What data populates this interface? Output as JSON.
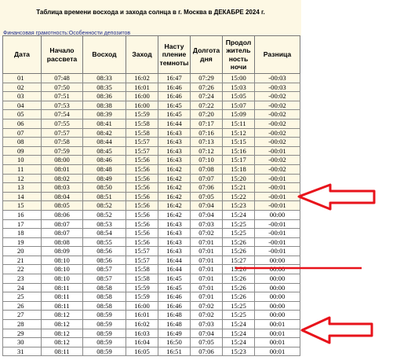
{
  "page_title": "Таблица времени восхода и захода солнца в г. Москва в ДЕКАБРЕ 2024 г.",
  "nav_link": "Финансовая грамотность:Особенности депозитов",
  "headers": [
    "Дата",
    "Начало рассвета",
    "Восход",
    "Заход",
    "Насту пление темноты",
    "Долгота дня",
    "Продол житель ность ночи",
    "Разница"
  ],
  "highlight_color": "#fdf8e4",
  "annotation_color": "#e8131b",
  "highlighted_rows": 15,
  "rows": [
    [
      "01",
      "07:48",
      "08:33",
      "16:02",
      "16:47",
      "07:29",
      "15:00",
      "-00:03"
    ],
    [
      "02",
      "07:50",
      "08:35",
      "16:01",
      "16:46",
      "07:26",
      "15:03",
      "-00:03"
    ],
    [
      "03",
      "07:51",
      "08:36",
      "16:00",
      "16:46",
      "07:24",
      "15:05",
      "-00:02"
    ],
    [
      "04",
      "07:53",
      "08:38",
      "16:00",
      "16:45",
      "07:22",
      "15:07",
      "-00:02"
    ],
    [
      "05",
      "07:54",
      "08:39",
      "15:59",
      "16:45",
      "07:20",
      "15:09",
      "-00:02"
    ],
    [
      "06",
      "07:55",
      "08:41",
      "15:58",
      "16:44",
      "07:17",
      "15:11",
      "-00:02"
    ],
    [
      "07",
      "07:57",
      "08:42",
      "15:58",
      "16:43",
      "07:16",
      "15:12",
      "-00:02"
    ],
    [
      "08",
      "07:58",
      "08:44",
      "15:57",
      "16:43",
      "07:13",
      "15:15",
      "-00:02"
    ],
    [
      "09",
      "07:59",
      "08:45",
      "15:57",
      "16:43",
      "07:12",
      "15:16",
      "-00:01"
    ],
    [
      "10",
      "08:00",
      "08:46",
      "15:56",
      "16:43",
      "07:10",
      "15:17",
      "-00:02"
    ],
    [
      "11",
      "08:01",
      "08:48",
      "15:56",
      "16:42",
      "07:08",
      "15:18",
      "-00:02"
    ],
    [
      "12",
      "08:02",
      "08:49",
      "15:56",
      "16:42",
      "07:07",
      "15:20",
      "-00:01"
    ],
    [
      "13",
      "08:03",
      "08:50",
      "15:56",
      "16:42",
      "07:06",
      "15:21",
      "-00:01"
    ],
    [
      "14",
      "08:04",
      "08:51",
      "15:56",
      "16:42",
      "07:05",
      "15:22",
      "-00:01"
    ],
    [
      "15",
      "08:05",
      "08:52",
      "15:56",
      "16:42",
      "07:04",
      "15:23",
      "-00:01"
    ],
    [
      "16",
      "08:06",
      "08:52",
      "15:56",
      "16:42",
      "07:04",
      "15:24",
      "00:00"
    ],
    [
      "17",
      "08:07",
      "08:53",
      "15:56",
      "16:43",
      "07:03",
      "15:25",
      "-00:01"
    ],
    [
      "18",
      "08:07",
      "08:54",
      "15:56",
      "16:43",
      "07:02",
      "15:25",
      "-00:01"
    ],
    [
      "19",
      "08:08",
      "08:55",
      "15:56",
      "16:43",
      "07:01",
      "15:26",
      "-00:01"
    ],
    [
      "20",
      "08:09",
      "08:56",
      "15:57",
      "16:43",
      "07:01",
      "15:26",
      "-00:01"
    ],
    [
      "21",
      "08:10",
      "08:56",
      "15:57",
      "16:44",
      "07:01",
      "15:27",
      "00:00"
    ],
    [
      "22",
      "08:10",
      "08:57",
      "15:58",
      "16:44",
      "07:01",
      "15:26",
      "00:00"
    ],
    [
      "23",
      "08:10",
      "08:57",
      "15:58",
      "16:45",
      "07:01",
      "15:26",
      "00:00"
    ],
    [
      "24",
      "08:11",
      "08:58",
      "15:59",
      "16:45",
      "07:01",
      "15:26",
      "00:00"
    ],
    [
      "25",
      "08:11",
      "08:58",
      "15:59",
      "16:46",
      "07:01",
      "15:26",
      "00:00"
    ],
    [
      "26",
      "08:11",
      "08:58",
      "16:00",
      "16:46",
      "07:02",
      "15:25",
      "00:00"
    ],
    [
      "27",
      "08:12",
      "08:59",
      "16:01",
      "16:48",
      "07:02",
      "15:25",
      "00:00"
    ],
    [
      "28",
      "08:12",
      "08:59",
      "16:02",
      "16:48",
      "07:03",
      "15:24",
      "00:01"
    ],
    [
      "29",
      "08:12",
      "08:59",
      "16:03",
      "16:49",
      "07:04",
      "15:24",
      "00:01"
    ],
    [
      "30",
      "08:12",
      "08:59",
      "16:04",
      "16:50",
      "07:05",
      "15:24",
      "00:01"
    ],
    [
      "31",
      "08:11",
      "08:59",
      "16:05",
      "16:51",
      "07:06",
      "15:23",
      "00:01"
    ]
  ]
}
